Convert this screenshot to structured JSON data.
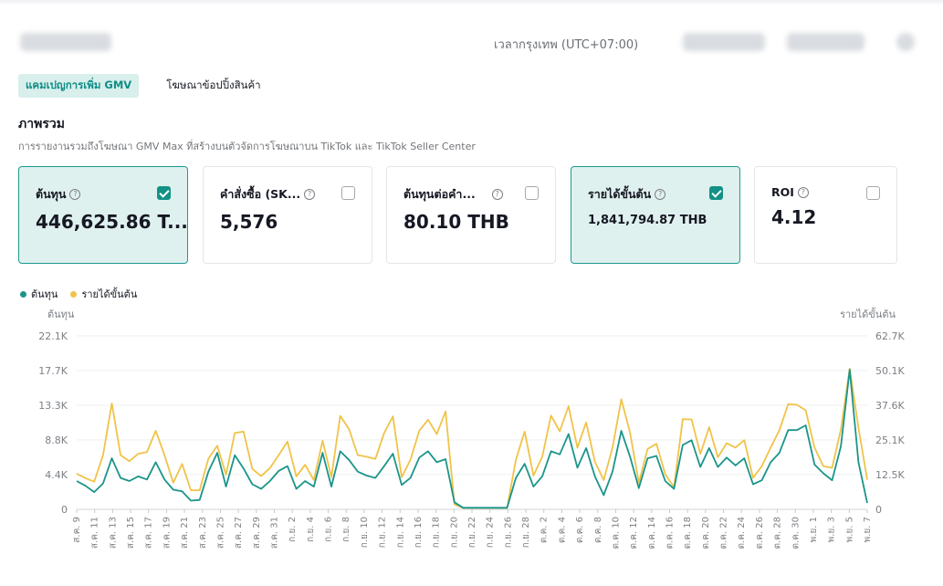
{
  "header": {
    "timezone": "เวลากรุงเทพ (UTC+07:00)"
  },
  "tabs": [
    {
      "label": "แคมเปญการเพิ่ม GMV",
      "active": true
    },
    {
      "label": "โฆษณาข้อปปิ้งสินค้า",
      "active": false
    }
  ],
  "overview": {
    "title": "ภาพรวม",
    "subtitle": "การรายงานรวมถึงโฆษณา GMV Max ที่สร้างบนตัวจัดการโฆษณาบน TikTok และ TikTok Seller Center"
  },
  "metrics": [
    {
      "label": "ต้นทุน",
      "value": "446,625.86 T...",
      "checked": true
    },
    {
      "label": "คำสั่งซื้อ (SK...",
      "value": "5,576",
      "checked": false
    },
    {
      "label": "ต้นทุนต่อคำ...",
      "value": "80.10 THB",
      "checked": false
    },
    {
      "label": "รายได้ขั้นต้น",
      "value": "1,841,794.87 THB",
      "checked": true
    },
    {
      "label": "ROI",
      "value": "4.12",
      "checked": false
    }
  ],
  "colors": {
    "accent": "#139186",
    "cost_series": "#1a958a",
    "revenue_series": "#f0c349"
  },
  "chart_data": {
    "type": "line",
    "legend": [
      "ต้นทุน",
      "รายได้ขั้นต้น"
    ],
    "left_axis_title": "ต้นทุน",
    "right_axis_title": "รายได้ขั้นต้น",
    "left_ticks": [
      "22.1K",
      "17.7K",
      "13.3K",
      "8.8K",
      "4.4K",
      "0"
    ],
    "right_ticks": [
      "62.7K",
      "50.1K",
      "37.6K",
      "25.1K",
      "12.5K",
      "0"
    ],
    "left_ylim": [
      0,
      22100
    ],
    "right_ylim": [
      0,
      62700
    ],
    "x_tick_labels": [
      "ส.ค. 9",
      "ส.ค. 11",
      "ส.ค. 13",
      "ส.ค. 15",
      "ส.ค. 17",
      "ส.ค. 19",
      "ส.ค. 21",
      "ส.ค. 23",
      "ส.ค. 25",
      "ส.ค. 27",
      "ส.ค. 29",
      "ส.ค. 31",
      "ก.ย. 2",
      "ก.ย. 4",
      "ก.ย. 6",
      "ก.ย. 8",
      "ก.ย. 10",
      "ก.ย. 12",
      "ก.ย. 14",
      "ก.ย. 16",
      "ก.ย. 18",
      "ก.ย. 20",
      "ก.ย. 22",
      "ก.ย. 24",
      "ก.ย. 26",
      "ก.ย. 28",
      "ต.ค. 2",
      "ต.ค. 4",
      "ต.ค. 6",
      "ต.ค. 8",
      "ต.ค. 10",
      "ต.ค. 12",
      "ต.ค. 14",
      "ต.ค. 16",
      "ต.ค. 18",
      "ต.ค. 20",
      "ต.ค. 22",
      "ต.ค. 24",
      "ต.ค. 26",
      "ต.ค. 28",
      "ต.ค. 30",
      "พ.ย. 1",
      "พ.ย. 3",
      "พ.ย. 5",
      "พ.ย. 7"
    ],
    "series": [
      {
        "name": "ต้นทุน",
        "axis": "left",
        "values": [
          3600,
          3000,
          2200,
          3300,
          6500,
          4000,
          3600,
          4200,
          3800,
          6000,
          3800,
          2500,
          2300,
          1100,
          1200,
          4800,
          7200,
          2900,
          6900,
          5200,
          3200,
          2600,
          3600,
          4900,
          5500,
          2600,
          3600,
          2900,
          7200,
          2900,
          7400,
          6300,
          4800,
          4300,
          4000,
          5500,
          7100,
          3100,
          4000,
          6600,
          7400,
          6000,
          6400,
          900,
          200,
          200,
          200,
          200,
          200,
          200,
          4000,
          5800,
          2900,
          4200,
          7400,
          7000,
          9600,
          5300,
          7800,
          4200,
          1800,
          4800,
          10000,
          6700,
          2700,
          6500,
          6800,
          3600,
          2600,
          8200,
          8800,
          5400,
          7800,
          5400,
          6600,
          5600,
          6500,
          3200,
          3700,
          6000,
          7200,
          10100,
          10100,
          10700,
          5700,
          4600,
          3700,
          8000,
          17800,
          6000,
          800
        ]
      },
      {
        "name": "รายได้ขั้นต้น",
        "axis": "right",
        "values": [
          12900,
          11300,
          10000,
          19600,
          38300,
          19600,
          17400,
          20100,
          20700,
          28400,
          19600,
          9600,
          16400,
          6900,
          6900,
          18300,
          23000,
          12500,
          27600,
          28100,
          14600,
          12000,
          14900,
          19600,
          24500,
          11900,
          16100,
          10600,
          24800,
          11600,
          33800,
          29000,
          19600,
          19000,
          18200,
          27600,
          33600,
          11600,
          17900,
          28400,
          32400,
          27200,
          35400,
          1800,
          500,
          500,
          500,
          500,
          500,
          500,
          17900,
          28100,
          12200,
          19000,
          33900,
          28200,
          37300,
          22300,
          31400,
          17200,
          10600,
          22300,
          39800,
          27700,
          9600,
          21800,
          23700,
          12700,
          8000,
          32600,
          32500,
          20000,
          29700,
          18800,
          23900,
          22300,
          25000,
          11400,
          15600,
          22300,
          28600,
          38000,
          37800,
          35800,
          22300,
          15600,
          15000,
          28800,
          50900,
          29500,
          10700
        ]
      }
    ]
  }
}
